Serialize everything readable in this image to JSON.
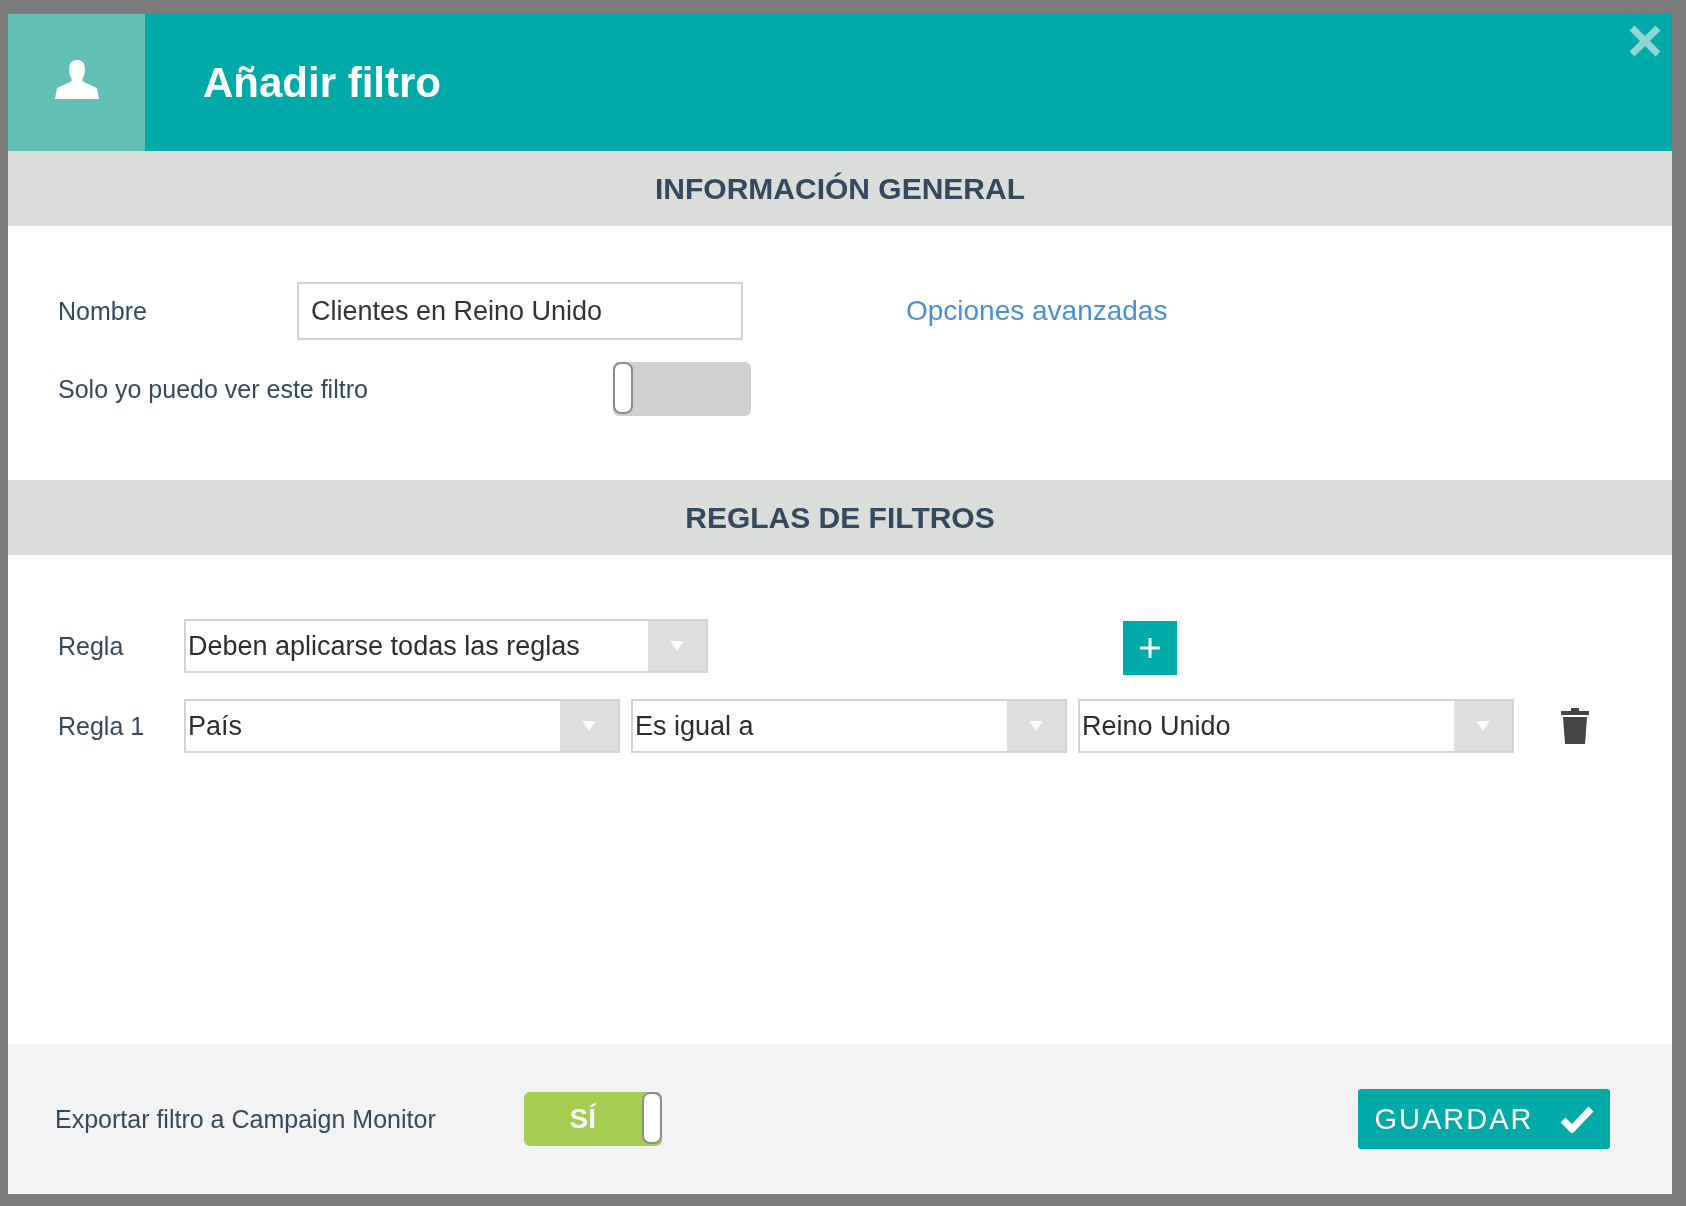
{
  "dialog": {
    "title": "Añadir filtro"
  },
  "general": {
    "heading": "INFORMACIÓN GENERAL",
    "name_label": "Nombre",
    "name_value": "Clientes en Reino Unido",
    "advanced_link": "Opciones avanzadas",
    "private_label": "Solo yo puedo ver este filtro",
    "private_on": false
  },
  "rules": {
    "heading": "REGLAS DE FILTROS",
    "rule_label": "Regla",
    "rule_value": "Deben aplicarse todas las reglas",
    "items": [
      {
        "label": "Regla 1",
        "field": "País",
        "operator": "Es igual a",
        "value": "Reino Unido"
      }
    ]
  },
  "footer": {
    "export_label": "Exportar filtro a Campaign Monitor",
    "export_on": true,
    "export_on_text": "SÍ",
    "save_button": "GUARDAR"
  }
}
